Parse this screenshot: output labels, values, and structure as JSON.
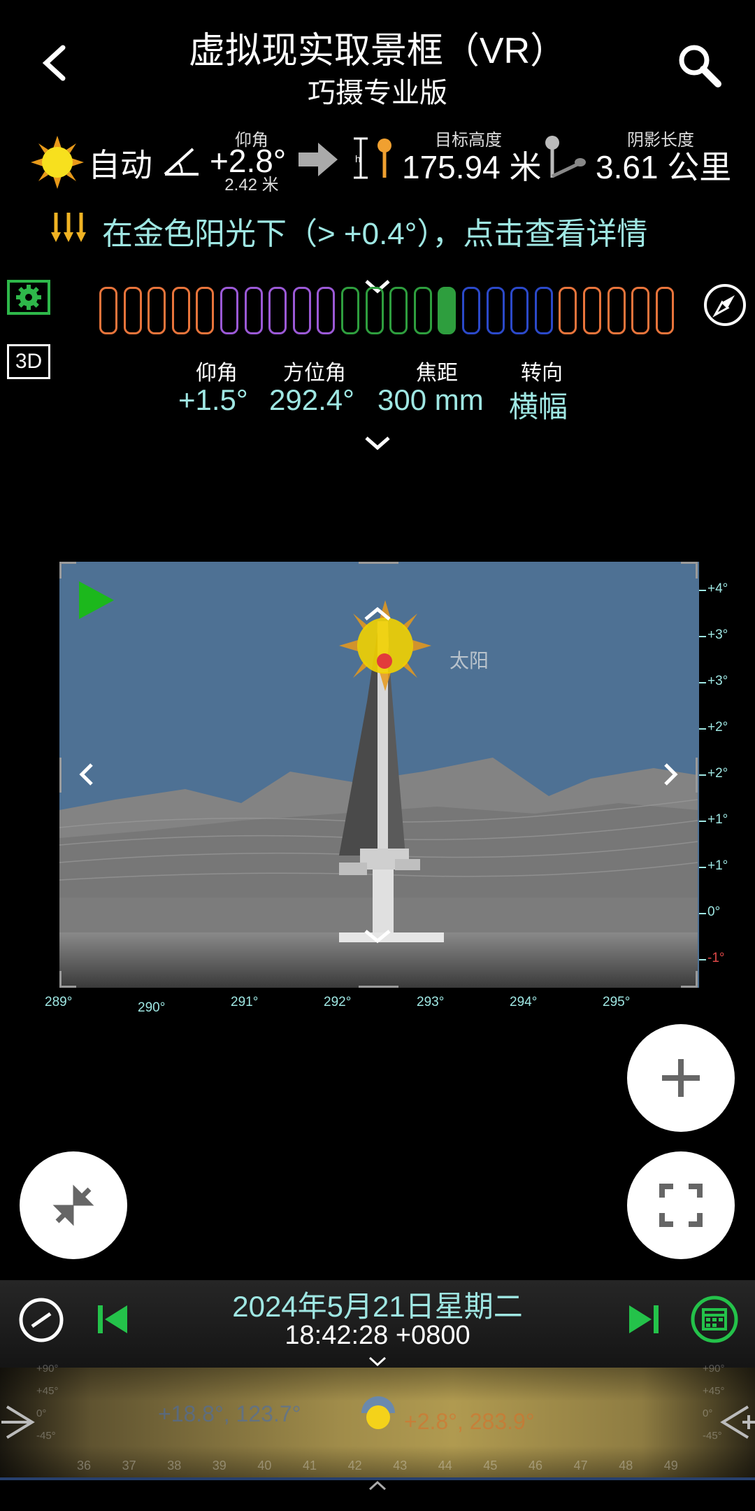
{
  "header": {
    "title": "虚拟现实取景框（VR）",
    "subtitle": "巧摄专业版"
  },
  "info_bar": {
    "mode_label": "自动",
    "elevation_caption": "仰角",
    "elevation_value": "+2.8°",
    "elevation_sub": "2.42 米",
    "target_height_caption": "目标高度",
    "target_height_value": "175.94 米",
    "shadow_caption": "阴影长度",
    "shadow_value": "3.61 公里"
  },
  "golden_banner": "在金色阳光下（> +0.4°），点击查看详情",
  "segment_bar": {
    "colors": [
      "#e8743b",
      "#e8743b",
      "#e8743b",
      "#e8743b",
      "#e8743b",
      "#9b59d6",
      "#9b59d6",
      "#9b59d6",
      "#9b59d6",
      "#9b59d6",
      "#2e9e3e",
      "#2e9e3e",
      "#2e9e3e",
      "#2e9e3e",
      "#2e9e3e",
      "#2b49c9",
      "#2b49c9",
      "#2b49c9",
      "#2b49c9",
      "#e8743b",
      "#e8743b",
      "#e8743b",
      "#e8743b",
      "#e8743b"
    ],
    "active_index": 14
  },
  "side_buttons": {
    "three_d": "3D"
  },
  "camera": {
    "elevation_caption": "仰角",
    "elevation_value": "+1.5°",
    "azimuth_caption": "方位角",
    "azimuth_value": "292.4°",
    "focal_caption": "焦距",
    "focal_value": "300 mm",
    "orientation_caption": "转向",
    "orientation_value": "横幅"
  },
  "viewfinder": {
    "sun_label": "太阳",
    "right_ticks": [
      "+4°",
      "+3°",
      "+3°",
      "+2°",
      "+2°",
      "+1°",
      "+1°",
      "0°",
      "-1°"
    ],
    "bottom_ticks": [
      "289°",
      "290°",
      "291°",
      "292°",
      "293°",
      "294°",
      "295°"
    ]
  },
  "bottom": {
    "date": "2024年5月21日星期二",
    "time": "18:42:28 +0800",
    "timeline_left_readout": "+18.8°, 123.7°",
    "timeline_right_readout": "+2.8°, 283.9°",
    "timeline_left_scale": [
      "+90°",
      "+45°",
      "0°",
      "-45°"
    ],
    "timeline_right_scale": [
      "+90°",
      "+45°",
      "0°",
      "-45°"
    ],
    "timeline_hours": [
      "36",
      "37",
      "38",
      "39",
      "40",
      "41",
      "42",
      "43",
      "44",
      "45",
      "46",
      "47",
      "48",
      "49"
    ]
  }
}
